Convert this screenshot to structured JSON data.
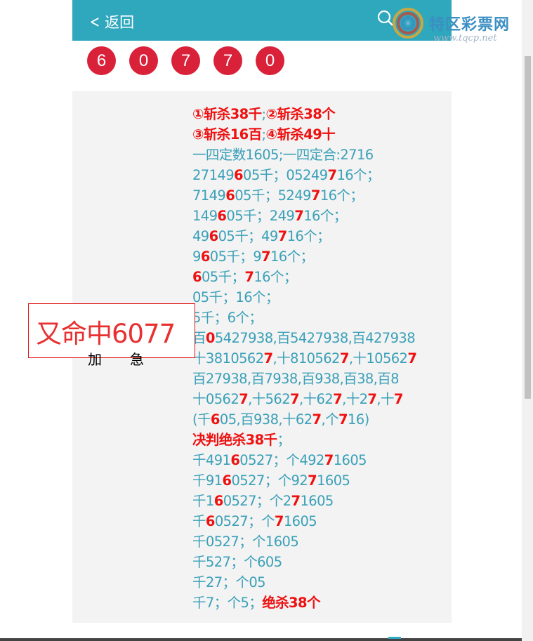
{
  "header": {
    "back_label": "返回",
    "site_name": "特区彩票网",
    "site_url": "www.tqcp.net"
  },
  "balls": [
    "6",
    "0",
    "7",
    "7",
    "0"
  ],
  "promo": {
    "headline": "又命中6077",
    "sub": "加急"
  },
  "content": [
    [
      {
        "t": "①斩杀38千",
        "r": true
      },
      {
        "t": ";"
      },
      {
        "t": "②斩杀38个",
        "r": true
      }
    ],
    [
      {
        "t": "③斩杀16百",
        "r": true
      },
      {
        "t": ";"
      },
      {
        "t": "④斩杀49十",
        "r": true
      }
    ],
    [
      {
        "t": "一四定数1605;一四定合:2716"
      }
    ],
    [
      {
        "t": "27149"
      },
      {
        "t": "6",
        "r": true
      },
      {
        "t": "05千；05249"
      },
      {
        "t": "7",
        "r": true
      },
      {
        "t": "16个；"
      }
    ],
    [
      {
        "t": "7149"
      },
      {
        "t": "6",
        "r": true
      },
      {
        "t": "05千；5249"
      },
      {
        "t": "7",
        "r": true
      },
      {
        "t": "16个；"
      }
    ],
    [
      {
        "t": "149"
      },
      {
        "t": "6",
        "r": true
      },
      {
        "t": "05千；249"
      },
      {
        "t": "7",
        "r": true
      },
      {
        "t": "16个；"
      }
    ],
    [
      {
        "t": "49"
      },
      {
        "t": "6",
        "r": true
      },
      {
        "t": "05千；49"
      },
      {
        "t": "7",
        "r": true
      },
      {
        "t": "16个；"
      }
    ],
    [
      {
        "t": "9"
      },
      {
        "t": "6",
        "r": true
      },
      {
        "t": "05千；9"
      },
      {
        "t": "7",
        "r": true
      },
      {
        "t": "16个；"
      }
    ],
    [
      {
        "t": "6",
        "r": true
      },
      {
        "t": "05千；"
      },
      {
        "t": "7",
        "r": true
      },
      {
        "t": "16个；"
      }
    ],
    [
      {
        "t": "05千；16个；"
      }
    ],
    [
      {
        "t": "5千；6个；"
      }
    ],
    [
      {
        "t": "百"
      },
      {
        "t": "0",
        "r": true
      },
      {
        "t": "5427938,百5427938,百427938"
      }
    ],
    [
      {
        "t": "十3810562"
      },
      {
        "t": "7",
        "r": true
      },
      {
        "t": ",十810562"
      },
      {
        "t": "7",
        "r": true
      },
      {
        "t": ",十10562"
      },
      {
        "t": "7",
        "r": true
      }
    ],
    [
      {
        "t": "百27938,百7938,百938,百38,百8"
      }
    ],
    [
      {
        "t": "十0562"
      },
      {
        "t": "7",
        "r": true
      },
      {
        "t": ",十562"
      },
      {
        "t": "7",
        "r": true
      },
      {
        "t": ",十62"
      },
      {
        "t": "7",
        "r": true
      },
      {
        "t": ",十2"
      },
      {
        "t": "7",
        "r": true
      },
      {
        "t": ",十"
      },
      {
        "t": "7",
        "r": true
      }
    ],
    [
      {
        "t": "(千"
      },
      {
        "t": "6",
        "r": true
      },
      {
        "t": "05,百938,十62"
      },
      {
        "t": "7",
        "r": true
      },
      {
        "t": ",个"
      },
      {
        "t": "7",
        "r": true
      },
      {
        "t": "16)"
      }
    ],
    [
      {
        "t": "决判绝杀38千",
        "r": true
      },
      {
        "t": "；"
      }
    ],
    [
      {
        "t": "千491"
      },
      {
        "t": "6",
        "r": true
      },
      {
        "t": "0527；个492"
      },
      {
        "t": "7",
        "r": true
      },
      {
        "t": "1605"
      }
    ],
    [
      {
        "t": "千91"
      },
      {
        "t": "6",
        "r": true
      },
      {
        "t": "0527；个92"
      },
      {
        "t": "7",
        "r": true
      },
      {
        "t": "1605"
      }
    ],
    [
      {
        "t": "千1"
      },
      {
        "t": "6",
        "r": true
      },
      {
        "t": "0527；个2"
      },
      {
        "t": "7",
        "r": true
      },
      {
        "t": "1605"
      }
    ],
    [
      {
        "t": "千"
      },
      {
        "t": "6",
        "r": true
      },
      {
        "t": "0527；个"
      },
      {
        "t": "7",
        "r": true
      },
      {
        "t": "1605"
      }
    ],
    [
      {
        "t": "千0527；个1605"
      }
    ],
    [
      {
        "t": "千527；个605"
      }
    ],
    [
      {
        "t": "千27；个05"
      }
    ],
    [
      {
        "t": "千7；个5；"
      },
      {
        "t": "绝杀38个",
        "r": true
      }
    ]
  ],
  "colors": {
    "header_bg": "#2fa7bd",
    "ball_bg": "#d9213a",
    "text_teal": "#3aa0b8",
    "highlight_red": "#ee1111"
  }
}
